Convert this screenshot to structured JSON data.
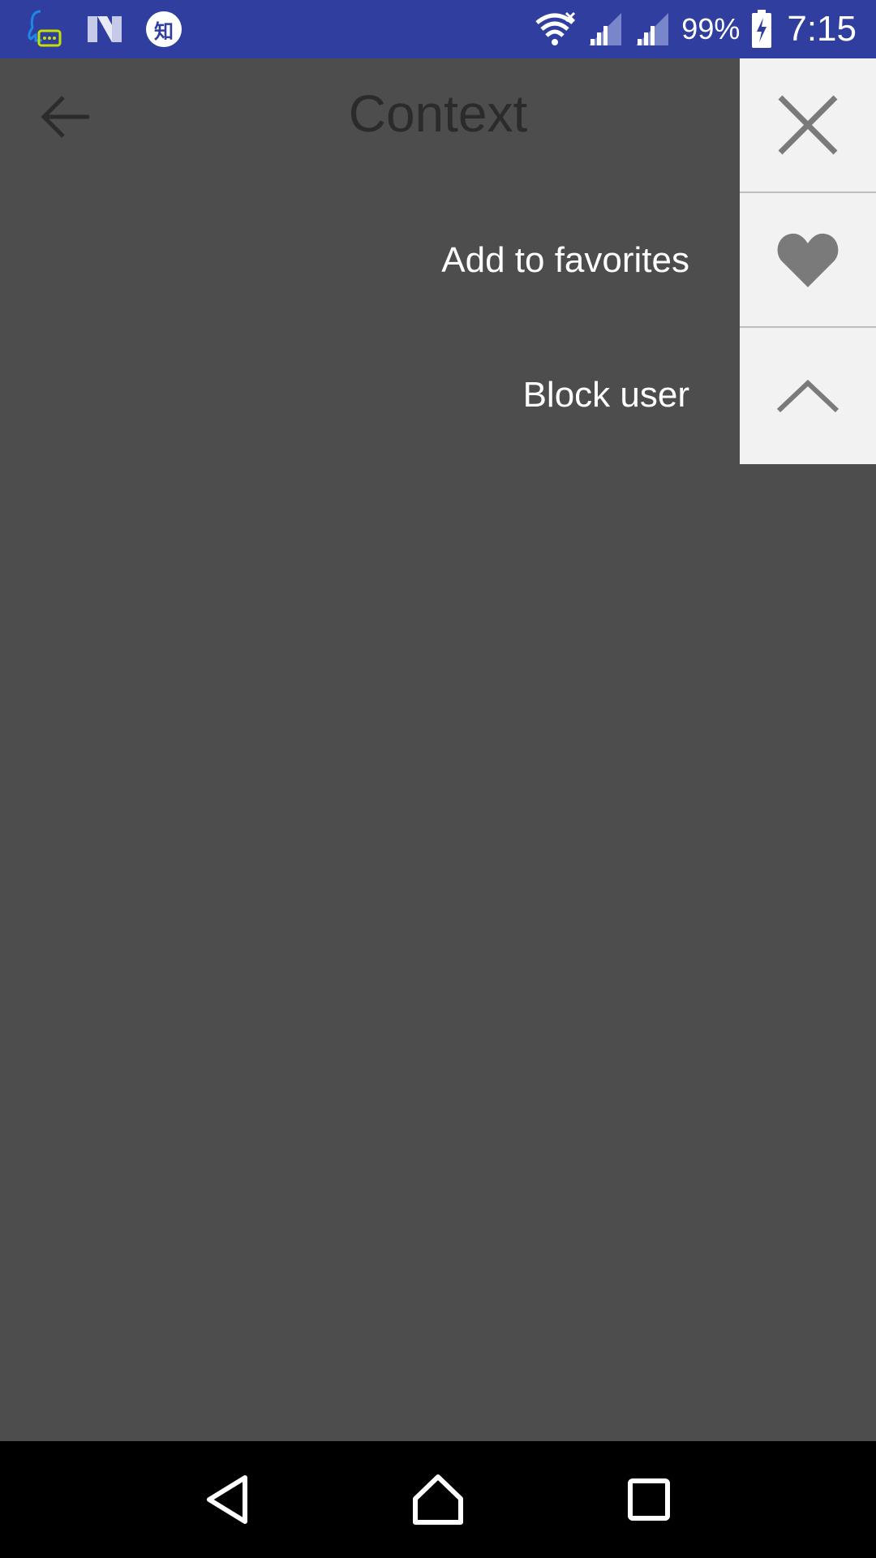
{
  "status_bar": {
    "left_icons": [
      "qq-chat-icon",
      "n-logo-icon",
      "zhihu-icon"
    ],
    "zhihu_glyph": "知",
    "battery": "99%",
    "time": "7:15",
    "bg_color": "#303f9f"
  },
  "app_bar": {
    "title": "Context"
  },
  "context_menu": {
    "items": [
      {
        "label": "",
        "icon": "close-icon"
      },
      {
        "label": "Add to favorites",
        "icon": "heart-icon"
      },
      {
        "label": "Block user",
        "icon": "chevron-up-icon"
      }
    ]
  },
  "nav_bar": {
    "buttons": [
      "back-triangle-icon",
      "home-icon",
      "recents-square-icon"
    ]
  }
}
